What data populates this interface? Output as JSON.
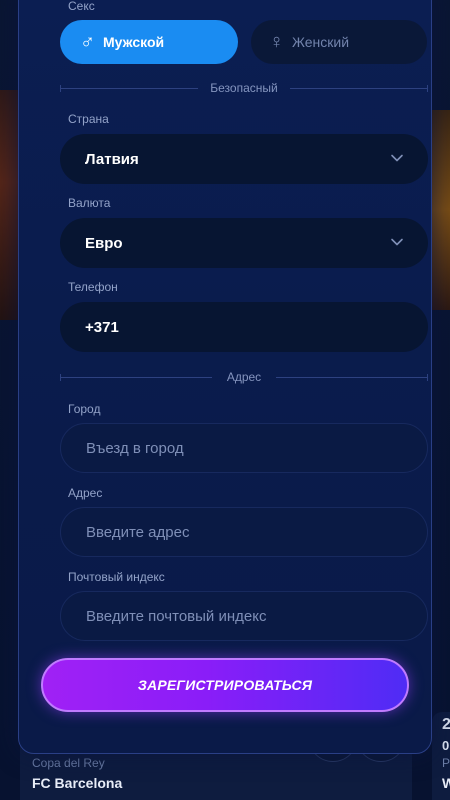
{
  "background": {
    "card_left": {
      "league": "Copa del Rey",
      "team": "FC Barcelona"
    },
    "card_right": {
      "num": "2",
      "small": "0",
      "league": "P",
      "team": "W"
    }
  },
  "form": {
    "sex_label": "Секс",
    "gender": {
      "male_label": "Мужской",
      "female_label": "Женский",
      "male_icon": "♂",
      "female_icon": "♀",
      "selected": "male"
    },
    "section_security": "Безопасный",
    "country": {
      "label": "Страна",
      "value": "Латвия"
    },
    "currency": {
      "label": "Валюта",
      "value": "Евро"
    },
    "phone": {
      "label": "Телефон",
      "value": "+371"
    },
    "section_address": "Адрес",
    "city": {
      "label": "Город",
      "placeholder": "Въезд в город"
    },
    "address": {
      "label": "Адрес",
      "placeholder": "Введите адрес"
    },
    "postal": {
      "label": "Почтовый индекс",
      "placeholder": "Введите почтовый индекс"
    },
    "submit_label": "ЗАРЕГИСТРИРОВАТЬСЯ"
  },
  "colors": {
    "accent_blue": "#1a8cf2",
    "submit_gradient_start": "#a021f5",
    "submit_gradient_end": "#4f2cf5",
    "modal_bg": "#0b1e52"
  }
}
